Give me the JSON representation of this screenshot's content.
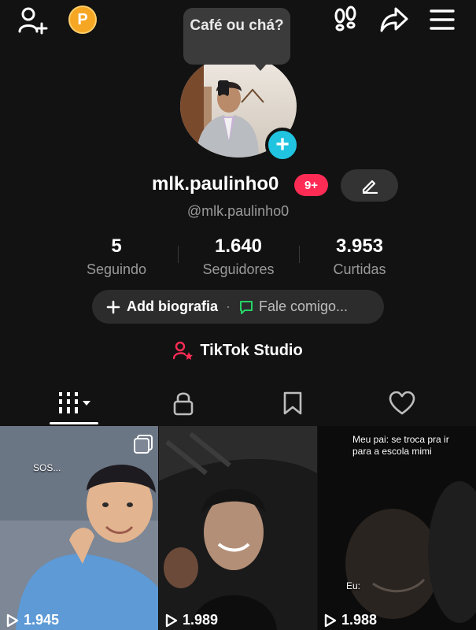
{
  "header": {
    "coin_letter": "P"
  },
  "profile": {
    "note_bubble": "Café ou chá?",
    "username": "mlk.paulinho0",
    "notification_badge": "9+",
    "handle": "@mlk.paulinho0",
    "add_avatar_symbol": "+"
  },
  "stats": [
    {
      "value": "5",
      "label": "Seguindo"
    },
    {
      "value": "1.640",
      "label": "Seguidores"
    },
    {
      "value": "3.953",
      "label": "Curtidas"
    }
  ],
  "bio": {
    "add_label": "Add biografia",
    "separator": "·",
    "contact_label": "Fale comigo..."
  },
  "studio": {
    "label": "TikTok Studio"
  },
  "tabs": [
    {
      "name": "videos",
      "icon": "grid-filter-icon",
      "selected": true
    },
    {
      "name": "private",
      "icon": "lock-icon"
    },
    {
      "name": "favorites",
      "icon": "bookmark-icon"
    },
    {
      "name": "liked",
      "icon": "heart-icon"
    }
  ],
  "videos": [
    {
      "views": "1.945",
      "overlay_text": "SOS..."
    },
    {
      "views": "1.989"
    },
    {
      "views": "1.988",
      "caption_top": "Meu pai: se troca pra ir para a escola mimi",
      "caption_mid": "Eu:"
    }
  ],
  "colors": {
    "background": "#121212",
    "accent_red": "#fe2c55",
    "accent_cyan": "#21c4e0",
    "coin_orange": "#f5a623",
    "message_green": "#25d366"
  }
}
